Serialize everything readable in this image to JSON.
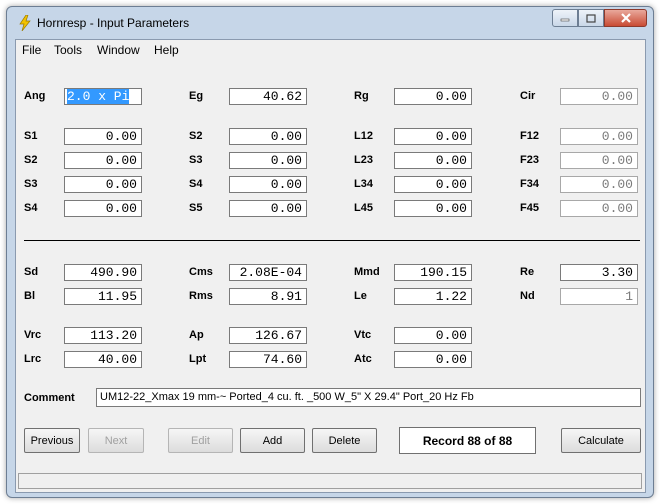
{
  "window": {
    "title": "Hornresp - Input Parameters",
    "icon": "lightning-icon",
    "controls": {
      "minimize": "minimize-icon",
      "maximize": "maximize-icon",
      "close": "close-icon"
    }
  },
  "menu": [
    "File",
    "Tools",
    "Window",
    "Help"
  ],
  "rows": {
    "ang": {
      "l1": "Ang",
      "v1": "2.0 x Pi",
      "l2": "Eg",
      "v2": "40.62",
      "l3": "Rg",
      "v3": "0.00",
      "l4": "Cir",
      "v4": "0.00"
    },
    "r1": {
      "l1": "S1",
      "v1": "0.00",
      "l2": "S2",
      "v2": "0.00",
      "l3": "L12",
      "v3": "0.00",
      "l4": "F12",
      "v4": "0.00"
    },
    "r2": {
      "l1": "S2",
      "v1": "0.00",
      "l2": "S3",
      "v2": "0.00",
      "l3": "L23",
      "v3": "0.00",
      "l4": "F23",
      "v4": "0.00"
    },
    "r3": {
      "l1": "S3",
      "v1": "0.00",
      "l2": "S4",
      "v2": "0.00",
      "l3": "L34",
      "v3": "0.00",
      "l4": "F34",
      "v4": "0.00"
    },
    "r4": {
      "l1": "S4",
      "v1": "0.00",
      "l2": "S5",
      "v2": "0.00",
      "l3": "L45",
      "v3": "0.00",
      "l4": "F45",
      "v4": "0.00"
    },
    "sd": {
      "l1": "Sd",
      "v1": "490.90",
      "l2": "Cms",
      "v2": "2.08E-04",
      "l3": "Mmd",
      "v3": "190.15",
      "l4": "Re",
      "v4": "3.30"
    },
    "bl": {
      "l1": "Bl",
      "v1": "11.95",
      "l2": "Rms",
      "v2": "8.91",
      "l3": "Le",
      "v3": "1.22",
      "l4": "Nd",
      "v4": "1"
    },
    "vrc": {
      "l1": "Vrc",
      "v1": "113.20",
      "l2": "Ap",
      "v2": "126.67",
      "l3": "Vtc",
      "v3": "0.00"
    },
    "lrc": {
      "l1": "Lrc",
      "v1": "40.00",
      "l2": "Lpt",
      "v2": "74.60",
      "l3": "Atc",
      "v3": "0.00"
    }
  },
  "comment": {
    "label": "Comment",
    "value": "UM12-22_Xmax 19 mm-~ Ported_4 cu. ft. _500 W_5\" X 29.4\" Port_20 Hz Fb"
  },
  "buttons": {
    "previous": "Previous",
    "next": "Next",
    "edit": "Edit",
    "add": "Add",
    "delete": "Delete",
    "record": "Record 88 of 88",
    "calculate": "Calculate"
  }
}
